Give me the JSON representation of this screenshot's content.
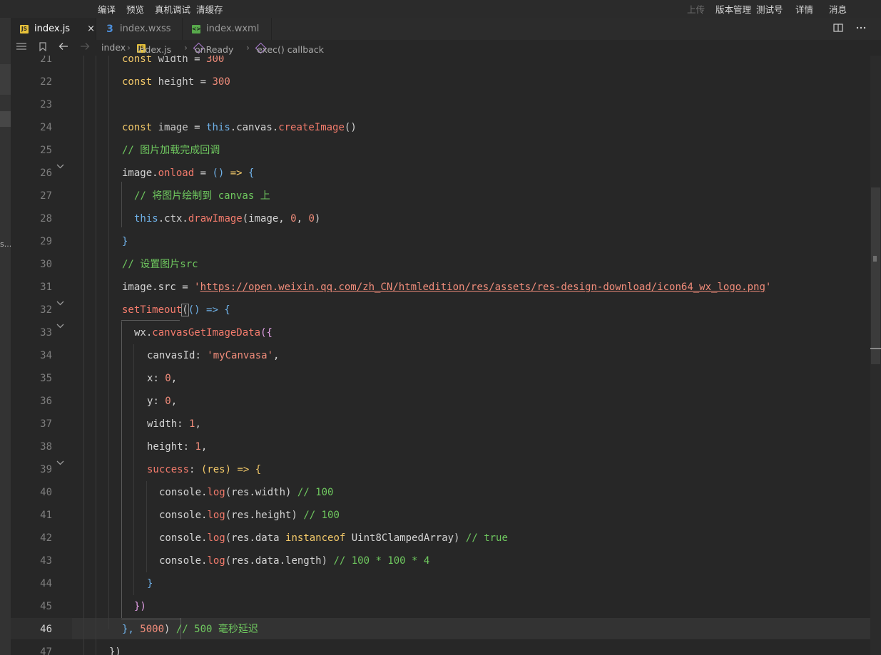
{
  "menubar": {
    "left": [
      "编译",
      "预览",
      "真机调试",
      "清缓存"
    ],
    "right": [
      "上传",
      "版本管理",
      "测试号",
      "详情",
      "消息"
    ]
  },
  "tabs": [
    {
      "label": "index.js",
      "icon": "js-file-icon",
      "active": true
    },
    {
      "label": "index.wxss",
      "icon": "css-file-icon",
      "active": false
    },
    {
      "label": "index.wxml",
      "icon": "wxml-file-icon",
      "active": false
    }
  ],
  "tab_close": "×",
  "icon_labels": {
    "js": "JS",
    "css": "3",
    "wxml": "<>"
  },
  "left_panel_text": "s...",
  "breadcrumb": {
    "folder": "index",
    "file": "index.js",
    "method": "onReady",
    "callback": "exec() callback"
  },
  "current_line": 46,
  "line_numbers": [
    21,
    22,
    23,
    24,
    25,
    26,
    27,
    28,
    29,
    30,
    31,
    32,
    33,
    34,
    35,
    36,
    37,
    38,
    39,
    40,
    41,
    42,
    43,
    44,
    45,
    46,
    47
  ],
  "code": {
    "l21": {
      "kw": "const",
      "name": "width",
      "op": " = ",
      "val": "300"
    },
    "l22": {
      "kw": "const",
      "name": "height",
      "op": " = ",
      "val": "300"
    },
    "l24": {
      "kw": "const",
      "name": "image",
      "op": " = ",
      "this": "this",
      "rest": ".canvas.",
      "fn": "createImage",
      "end": "()"
    },
    "l25": "// 图片加载完成回调",
    "l26": {
      "a": "image.",
      "fn": "onload",
      "op": " = ",
      "paren": "()",
      "arrow": " => ",
      "brace": "{"
    },
    "l27": "// 将图片绘制到 canvas 上",
    "l28": {
      "this": "this",
      "a": ".ctx.",
      "fn": "drawImage",
      "p1": "(image, ",
      "n1": "0",
      "c": ", ",
      "n2": "0",
      "p2": ")"
    },
    "l29": "}",
    "l30": "// 设置图片src",
    "l31": {
      "a": "image.src = ",
      "q1": "'",
      "url": "https://open.weixin.qq.com/zh_CN/htmledition/res/assets/res-design-download/icon64_wx_logo.png",
      "q2": "'"
    },
    "l32": {
      "fn": "setTimeout",
      "p": "(",
      "b": "() => {"
    },
    "l33": {
      "a": "wx.",
      "fn": "canvasGetImageData",
      "b": "({"
    },
    "l34": {
      "k": "canvasId",
      "c": ": ",
      "s": "'myCanvasa'",
      "e": ","
    },
    "l35": {
      "k": "x",
      "c": ": ",
      "n": "0",
      "e": ","
    },
    "l36": {
      "k": "y",
      "c": ": ",
      "n": "0",
      "e": ","
    },
    "l37": {
      "k": "width",
      "c": ": ",
      "n": "1",
      "e": ","
    },
    "l38": {
      "k": "height",
      "c": ": ",
      "n": "1",
      "e": ","
    },
    "l39": {
      "k": "success",
      "c": ": ",
      "p": "(res)",
      "a": " => {"
    },
    "l40": {
      "a": "console.",
      "fn": "log",
      "b": "(res.width) ",
      "cm": "// 100"
    },
    "l41": {
      "a": "console.",
      "fn": "log",
      "b": "(res.height) ",
      "cm": "// 100"
    },
    "l42": {
      "a": "console.",
      "fn": "log",
      "b": "(res.data ",
      "kw": "instanceof",
      "c": " Uint8ClampedArray) ",
      "cm": "// true"
    },
    "l43": {
      "a": "console.",
      "fn": "log",
      "b": "(res.data.length) ",
      "cm": "// 100 * 100 * 4"
    },
    "l44": "}",
    "l45": "})",
    "l46": {
      "a": "}, ",
      "n": "5000",
      "p": ")",
      "cm": " // 500 毫秒延迟"
    },
    "l47": "})"
  }
}
